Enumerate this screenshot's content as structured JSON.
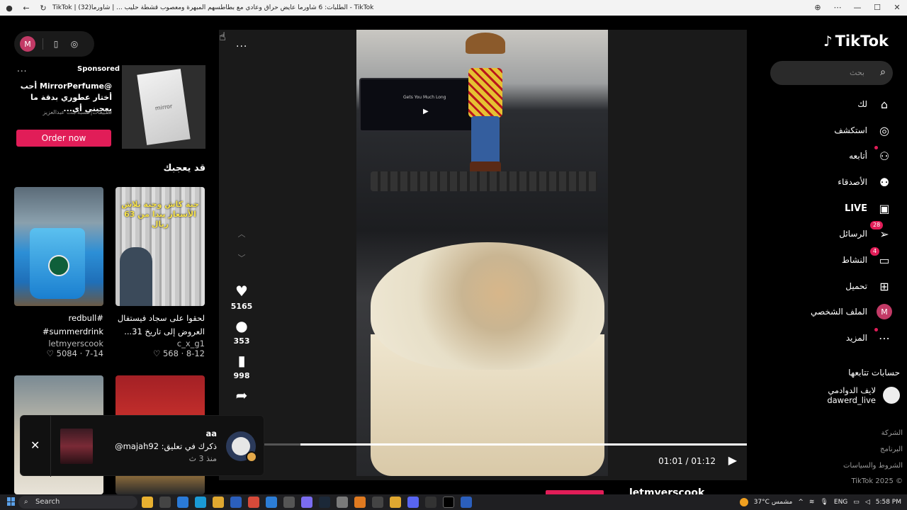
{
  "browser": {
    "title": "TikTok | الطلبات: 6 شاورما عايض حراق وعادي مع بطاطسهم المبهرة ومعصوب قشطة حليب ... | شاورما(32) - TikTok",
    "nav_icons": [
      "back-arrow-icon",
      "refresh-icon"
    ],
    "controls": [
      "zoom-icon",
      "more-icon",
      "minimize-icon",
      "maximize-icon",
      "close-icon"
    ]
  },
  "topbar": {
    "avatar_letter": "M"
  },
  "ad": {
    "dots": "...",
    "sponsored": "Sponsored",
    "title": "@MirrorPerfume أحب أختار عطوري بدقة ما يعجبني أي...",
    "sub": "تطبيقات|حسبة بنت عبدالعزيز",
    "order": "Order now",
    "thumb_text": "mirror"
  },
  "maylike": {
    "title": "قد يعجبك"
  },
  "cards": [
    {
      "caption": "#redbull #summerdrink",
      "author": "letmyerscook",
      "meta": "7-14 · 5084 ♡"
    },
    {
      "caption": "لحقوا على سجاد فيستفال العروض إلى تاريخ 31...",
      "author": "c_x_g1",
      "meta": "8-12 · 568 ♡",
      "overlay": "جبة كاش وجبة بلاش الأسعار يبدا من 63 ريال"
    },
    {
      "caption": "",
      "author": "",
      "meta": ""
    },
    {
      "caption": "",
      "author": "",
      "meta": ""
    }
  ],
  "player": {
    "more": "...",
    "counts": {
      "likes": "5165",
      "comments": "353",
      "saves": "998"
    },
    "time": "01:01 / 01:12",
    "progress": 0.92,
    "author": "letmyerscook",
    "screen_song": "Gets You Much Long"
  },
  "notification": {
    "line1": "aa",
    "line2": "ذكرك في تعليق: majah92@",
    "line3": "منذ 3 ث"
  },
  "sidebar": {
    "logo": "TikTok",
    "search_placeholder": "بحث",
    "nav": [
      {
        "label": "لك",
        "icon": "home-icon"
      },
      {
        "label": "استكشف",
        "icon": "compass-icon"
      },
      {
        "label": "أتابعه",
        "icon": "following-icon"
      },
      {
        "label": "الأصدقاء",
        "icon": "friends-icon"
      },
      {
        "label": "LIVE",
        "icon": "live-icon"
      },
      {
        "label": "الرسائل",
        "icon": "messages-icon",
        "badge": "28"
      },
      {
        "label": "النشاط",
        "icon": "activity-icon",
        "badge": "4"
      },
      {
        "label": "تحميل",
        "icon": "upload-icon"
      },
      {
        "label": "الملف الشخصي",
        "icon": "profile-avatar",
        "avatar": "M"
      },
      {
        "label": "المزيد",
        "icon": "more-icon"
      }
    ],
    "following_title": "حسابات تتابعها",
    "following": {
      "name": "لايف الدوادمي",
      "handle": "dawerd_live"
    },
    "footer": [
      "الشركة",
      "البرنامج",
      "الشروط والسياسات",
      "© 2025 TikTok"
    ]
  },
  "taskbar": {
    "search": "Search",
    "weather": "37°C مشمس",
    "lang": "ENG",
    "time": "5:58 PM"
  },
  "colors": {
    "accent": "#e11d58",
    "bg": "#000000",
    "panel": "#1a1a1a"
  }
}
